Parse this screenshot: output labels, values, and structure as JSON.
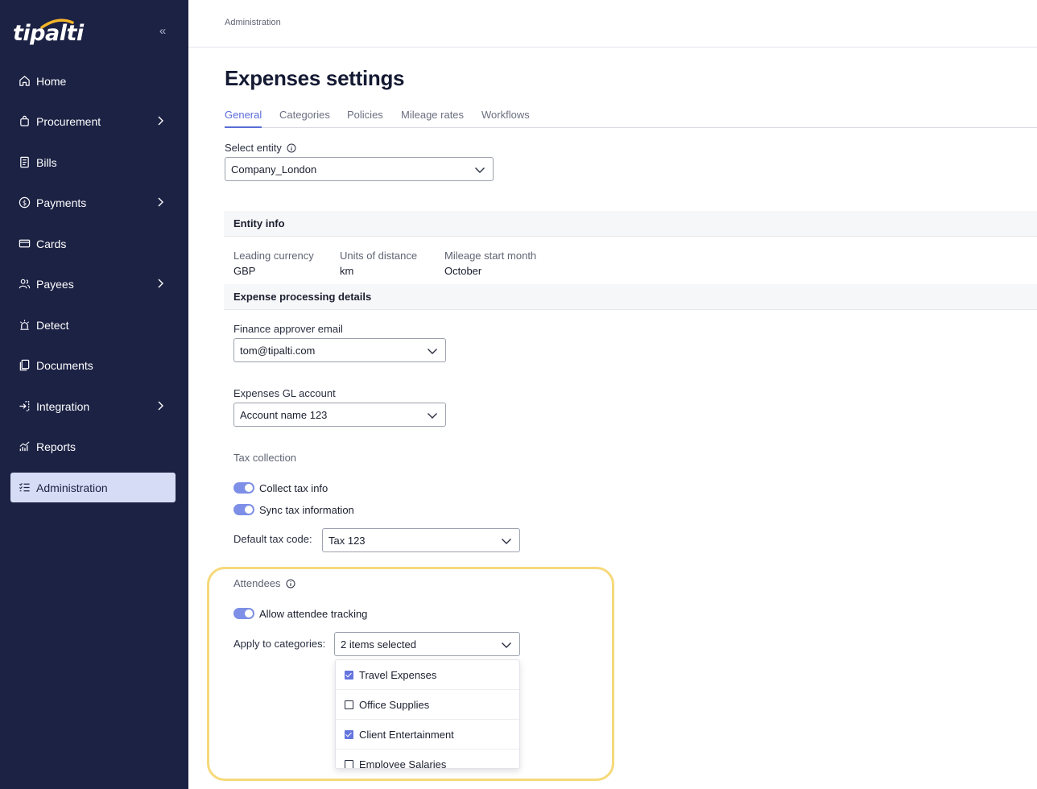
{
  "brand": {
    "logo_text": "tipalti",
    "accent": "#5b6dd8",
    "sidebar_bg": "#1c2244",
    "highlight_color": "#f6d97a"
  },
  "sidebar": {
    "collapse_label": "«",
    "items": [
      {
        "label": "Home",
        "icon": "home-icon",
        "has_chevron": false
      },
      {
        "label": "Procurement",
        "icon": "shopping-bag-icon",
        "has_chevron": true
      },
      {
        "label": "Bills",
        "icon": "bill-icon",
        "has_chevron": false
      },
      {
        "label": "Payments",
        "icon": "dollar-circle-icon",
        "has_chevron": true
      },
      {
        "label": "Cards",
        "icon": "credit-card-icon",
        "has_chevron": false
      },
      {
        "label": "Payees",
        "icon": "people-icon",
        "has_chevron": true
      },
      {
        "label": "Detect",
        "icon": "alarm-icon",
        "has_chevron": false
      },
      {
        "label": "Documents",
        "icon": "documents-icon",
        "has_chevron": false
      },
      {
        "label": "Integration",
        "icon": "integration-icon",
        "has_chevron": true
      },
      {
        "label": "Reports",
        "icon": "reports-icon",
        "has_chevron": false
      },
      {
        "label": "Administration",
        "icon": "checklist-icon",
        "has_chevron": false,
        "active": true
      }
    ]
  },
  "breadcrumb": "Administration",
  "page_title": "Expenses settings",
  "tabs": [
    {
      "label": "General",
      "active": true
    },
    {
      "label": "Categories"
    },
    {
      "label": "Policies"
    },
    {
      "label": "Mileage rates"
    },
    {
      "label": "Workflows"
    }
  ],
  "entity": {
    "label": "Select entity",
    "value": "Company_London"
  },
  "entity_info": {
    "heading": "Entity info",
    "fields": [
      {
        "key": "Leading currency",
        "value": "GBP"
      },
      {
        "key": "Units of distance",
        "value": "km"
      },
      {
        "key": "Mileage start month",
        "value": "October"
      }
    ]
  },
  "processing": {
    "heading": "Expense processing details",
    "finance_email_label": "Finance approver email",
    "finance_email_value": "tom@tipalti.com",
    "gl_label": "Expenses GL account",
    "gl_value": "Account name 123",
    "tax_heading": "Tax collection",
    "toggle_collect": "Collect tax info",
    "toggle_sync": "Sync tax information",
    "tax_code_label": "Default tax code:",
    "tax_code_value": "Tax 123"
  },
  "attendees": {
    "heading": "Attendees",
    "toggle_label": "Allow attendee tracking",
    "apply_label": "Apply to categories:",
    "apply_value": "2 items selected",
    "options": [
      {
        "label": "Travel Expenses",
        "checked": true
      },
      {
        "label": "Office Supplies",
        "checked": false
      },
      {
        "label": "Client Entertainment",
        "checked": true
      },
      {
        "label": "Employee Salaries",
        "checked": false
      }
    ]
  }
}
